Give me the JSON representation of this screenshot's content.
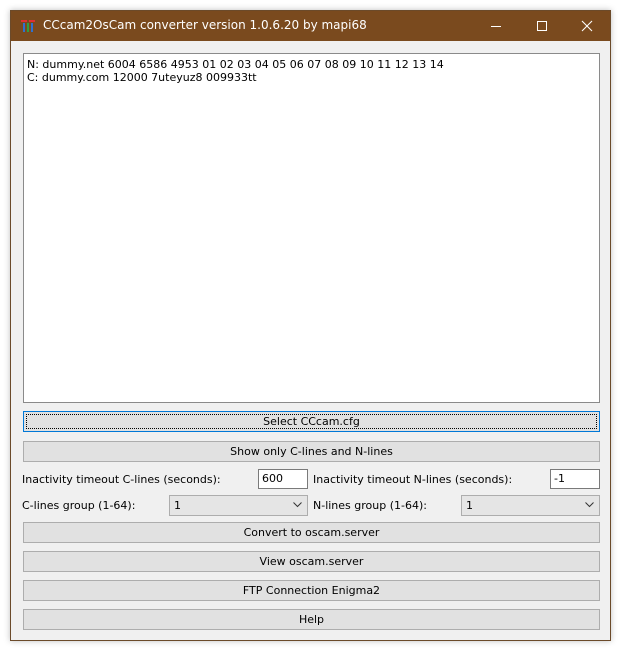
{
  "window": {
    "title": "CCcam2OsCam converter version 1.0.6.20 by mapi68",
    "titlebar_color": "#7a4a1e"
  },
  "content": {
    "lines": [
      "N: dummy.net 6004 6586 4953 01 02 03 04 05 06 07 08 09 10 11 12 13 14",
      "C: dummy.com 12000 7uteyuz8 009933tt"
    ]
  },
  "buttons": {
    "select_cfg": "Select CCcam.cfg",
    "show_only": "Show only C-lines and N-lines",
    "convert": "Convert to oscam.server",
    "view": "View oscam.server",
    "ftp": "FTP Connection Enigma2",
    "help": "Help"
  },
  "settings": {
    "timeout_c_label": "Inactivity timeout C-lines (seconds):",
    "timeout_c_value": "600",
    "timeout_n_label": "Inactivity timeout N-lines (seconds):",
    "timeout_n_value": "-1",
    "group_c_label": "C-lines group (1-64):",
    "group_c_value": "1",
    "group_n_label": "N-lines group (1-64):",
    "group_n_value": "1"
  }
}
